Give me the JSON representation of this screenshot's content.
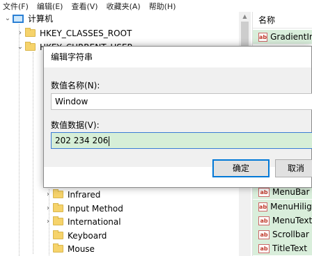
{
  "menubar": {
    "items": [
      "文件(F)",
      "编辑(E)",
      "查看(V)",
      "收藏夹(A)",
      "帮助(H)"
    ]
  },
  "tree": {
    "root": "计算机",
    "hkcr": "HKEY_CLASSES_ROOT",
    "hkcu": "HKEY_CURRENT_USER",
    "items": [
      "Infrared",
      "Input Method",
      "International",
      "Keyboard",
      "Mouse"
    ]
  },
  "list": {
    "header": "名称",
    "top_item": "GradientIn",
    "items": [
      "MenuBar",
      "MenuHiligh",
      "MenuText",
      "Scrollbar",
      "TitleText"
    ],
    "value_icon": "ab"
  },
  "dialog": {
    "title": "编辑字符串",
    "name_label": "数值名称(N):",
    "name_value": "Window",
    "data_label": "数值数据(V):",
    "data_value": "202 234 206",
    "ok_label": "确定",
    "cancel_label": "取消"
  }
}
